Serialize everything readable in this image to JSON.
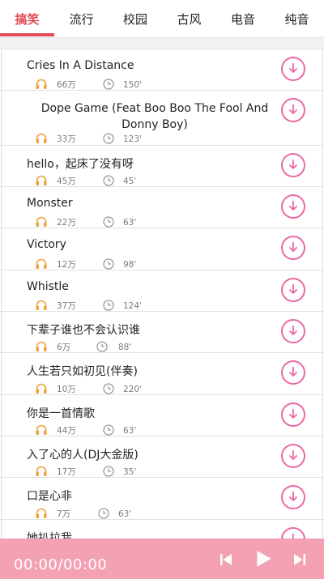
{
  "tabs": [
    {
      "label": "搞笑",
      "active": true
    },
    {
      "label": "流行",
      "active": false
    },
    {
      "label": "校园",
      "active": false
    },
    {
      "label": "古风",
      "active": false
    },
    {
      "label": "电音",
      "active": false
    },
    {
      "label": "纯音",
      "active": false
    }
  ],
  "songs": [
    {
      "title": "Cries In A Distance",
      "plays": "66万",
      "duration": "150'"
    },
    {
      "title": "Dope Game (Feat Boo Boo The Fool And Donny Boy)",
      "plays": "33万",
      "duration": "123'"
    },
    {
      "title": "hello，起床了没有呀",
      "plays": "45万",
      "duration": "45'"
    },
    {
      "title": "Monster",
      "plays": "22万",
      "duration": "63'"
    },
    {
      "title": "Victory",
      "plays": "12万",
      "duration": "98'"
    },
    {
      "title": "Whistle",
      "plays": "37万",
      "duration": "124'"
    },
    {
      "title": "下辈子谁也不会认识谁",
      "plays": "6万",
      "duration": "88'"
    },
    {
      "title": "人生若只如初见(伴奏)",
      "plays": "10万",
      "duration": "220'"
    },
    {
      "title": "你是一首情歌",
      "plays": "44万",
      "duration": "63'"
    },
    {
      "title": "入了心的人(DJ大金版)",
      "plays": "17万",
      "duration": "35'"
    },
    {
      "title": "口是心非",
      "plays": "7万",
      "duration": "63'"
    },
    {
      "title": "她扒拉我",
      "plays": "",
      "duration": ""
    }
  ],
  "player": {
    "time": "00:00/00:00"
  },
  "colors": {
    "accent": "#e24b57",
    "download": "#e96aa4",
    "player_bg": "#f3a1b3"
  }
}
